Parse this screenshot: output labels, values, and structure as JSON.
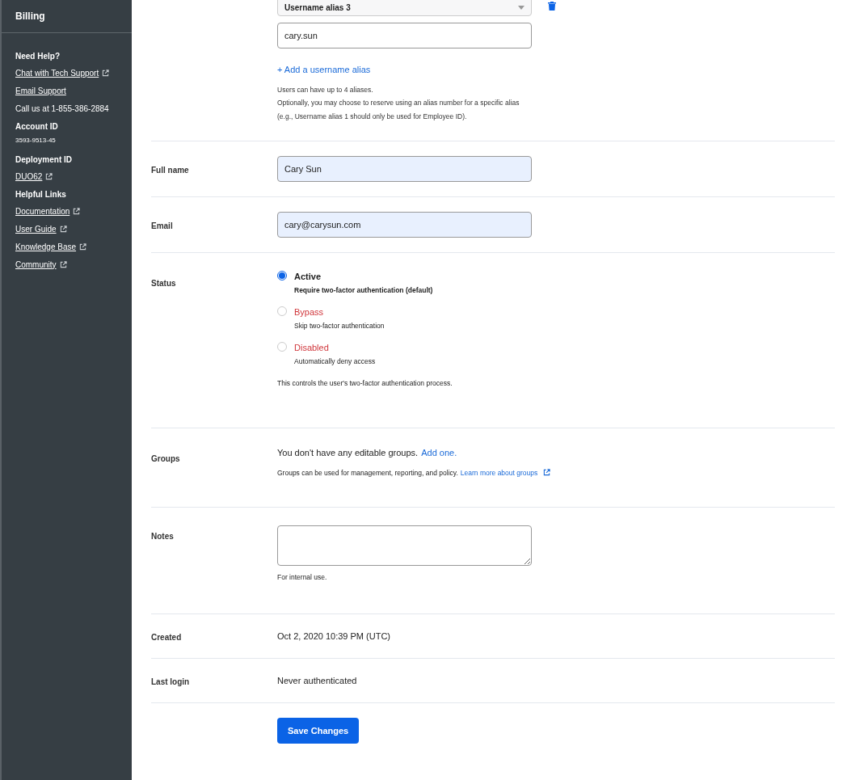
{
  "sidebar": {
    "title": "Billing",
    "items": [
      {
        "kind": "heading",
        "text": "Need Help?"
      },
      {
        "kind": "link",
        "text": "Chat with Tech Support",
        "external": true
      },
      {
        "kind": "link",
        "text": "Email Support",
        "external": false
      },
      {
        "kind": "text",
        "text": "Call us at 1-855-386-2884"
      },
      {
        "kind": "heading",
        "text": "Account ID"
      },
      {
        "kind": "small",
        "text": "3593-9513-45"
      },
      {
        "kind": "heading",
        "text": "Deployment ID"
      },
      {
        "kind": "link",
        "text": "DUO62",
        "external": true
      },
      {
        "kind": "heading",
        "text": "Helpful Links"
      },
      {
        "kind": "link",
        "text": "Documentation",
        "external": true
      },
      {
        "kind": "link",
        "text": "User Guide",
        "external": true
      },
      {
        "kind": "link",
        "text": "Knowledge Base",
        "external": true
      },
      {
        "kind": "link",
        "text": "Community",
        "external": true
      }
    ]
  },
  "alias": {
    "select": "Username alias 3",
    "value": "cary.sun",
    "add_link": "+ Add a username alias",
    "help": [
      "Users can have up to 4 aliases.",
      "Optionally, you may choose to reserve using an alias number for a specific alias",
      "(e.g., Username alias 1 should only be used for Employee ID)."
    ]
  },
  "full_name": {
    "label": "Full name",
    "value": "Cary Sun"
  },
  "email": {
    "label": "Email",
    "value": "cary@carysun.com"
  },
  "status": {
    "label": "Status",
    "options": [
      {
        "label": "Active",
        "description": "Require two-factor authentication (default)",
        "selected": true,
        "color": "#222222"
      },
      {
        "label": "Bypass",
        "description": "Skip two-factor authentication",
        "selected": false,
        "color": "#d0363b"
      },
      {
        "label": "Disabled",
        "description": "Automatically deny access",
        "selected": false,
        "color": "#d0363b"
      }
    ],
    "help": "This controls the user's two-factor authentication process."
  },
  "groups": {
    "label": "Groups",
    "message": "You don't have any editable groups.",
    "add_link": "Add one.",
    "help": "Groups can be used for management, reporting, and policy.",
    "help_link": "Learn more about groups"
  },
  "notes": {
    "label": "Notes",
    "help": "For internal use."
  },
  "created": {
    "label": "Created",
    "value": "Oct 2, 2020 10:39 PM (UTC)"
  },
  "last_login": {
    "label": "Last login",
    "value": "Never authenticated"
  },
  "save_button": "Save Changes"
}
